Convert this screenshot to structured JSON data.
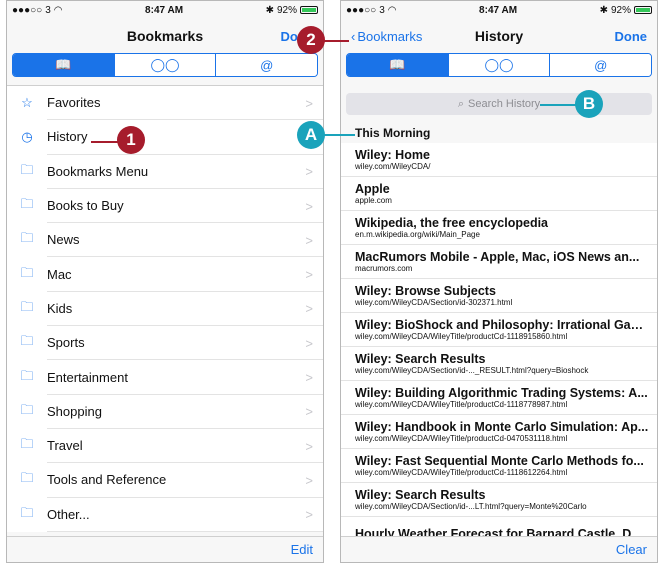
{
  "status": {
    "carrier": "3",
    "time": "8:47 AM",
    "battery": "92%",
    "battery_level": 0.92
  },
  "left": {
    "nav_title": "Bookmarks",
    "done_label": "Done",
    "tabs": [
      "📖",
      "◯◯",
      "@"
    ],
    "items": [
      {
        "label": "Favorites",
        "icon": "star-icon"
      },
      {
        "label": "History",
        "icon": "clock-icon"
      },
      {
        "label": "Bookmarks Menu",
        "icon": "folder-icon"
      },
      {
        "label": "Books to Buy",
        "icon": "folder-icon"
      },
      {
        "label": "News",
        "icon": "folder-icon"
      },
      {
        "label": "Mac",
        "icon": "folder-icon"
      },
      {
        "label": "Kids",
        "icon": "folder-icon"
      },
      {
        "label": "Sports",
        "icon": "folder-icon"
      },
      {
        "label": "Entertainment",
        "icon": "folder-icon"
      },
      {
        "label": "Shopping",
        "icon": "folder-icon"
      },
      {
        "label": "Travel",
        "icon": "folder-icon"
      },
      {
        "label": "Tools and Reference",
        "icon": "folder-icon"
      },
      {
        "label": "Other...",
        "icon": "folder-icon"
      }
    ],
    "edit_label": "Edit"
  },
  "right": {
    "back_label": "Bookmarks",
    "nav_title": "History",
    "done_label": "Done",
    "tabs": [
      "📖",
      "◯◯",
      "@"
    ],
    "search_placeholder": "Search History",
    "section_title": "This Morning",
    "history": [
      {
        "title": "Wiley: Home",
        "url": "wiley.com/WileyCDA/"
      },
      {
        "title": "Apple",
        "url": "apple.com"
      },
      {
        "title": "Wikipedia, the free encyclopedia",
        "url": "en.m.wikipedia.org/wiki/Main_Page"
      },
      {
        "title": "MacRumors Mobile - Apple, Mac, iOS News an...",
        "url": "macrumors.com"
      },
      {
        "title": "Wiley: Browse Subjects",
        "url": "wiley.com/WileyCDA/Section/id-302371.html"
      },
      {
        "title": "Wiley: BioShock and Philosophy: Irrational Gam...",
        "url": "wiley.com/WileyCDA/WileyTitle/productCd-1118915860.html"
      },
      {
        "title": "Wiley: Search Results",
        "url": "wiley.com/WileyCDA/Section/id-..._RESULT.html?query=Bioshock"
      },
      {
        "title": "Wiley: Building Algorithmic Trading Systems: A...",
        "url": "wiley.com/WileyCDA/WileyTitle/productCd-1118778987.html"
      },
      {
        "title": "Wiley: Handbook in Monte Carlo Simulation: Ap...",
        "url": "wiley.com/WileyCDA/WileyTitle/productCd-0470531118.html"
      },
      {
        "title": "Wiley: Fast Sequential Monte Carlo Methods fo...",
        "url": "wiley.com/WileyCDA/WileyTitle/productCd-1118612264.html"
      },
      {
        "title": "Wiley: Search Results",
        "url": "wiley.com/WileyCDA/Section/id-...LT.html?query=Monte%20Carlo"
      },
      {
        "title": "Hourly Weather Forecast for Barnard Castle, D...",
        "url": ""
      }
    ],
    "clear_label": "Clear"
  },
  "callouts": {
    "one": "1",
    "two": "2",
    "a": "A",
    "b": "B"
  },
  "colors": {
    "accent": "#1a73e8",
    "callout_red": "#a61c2c",
    "callout_teal": "#1aa3bb"
  }
}
